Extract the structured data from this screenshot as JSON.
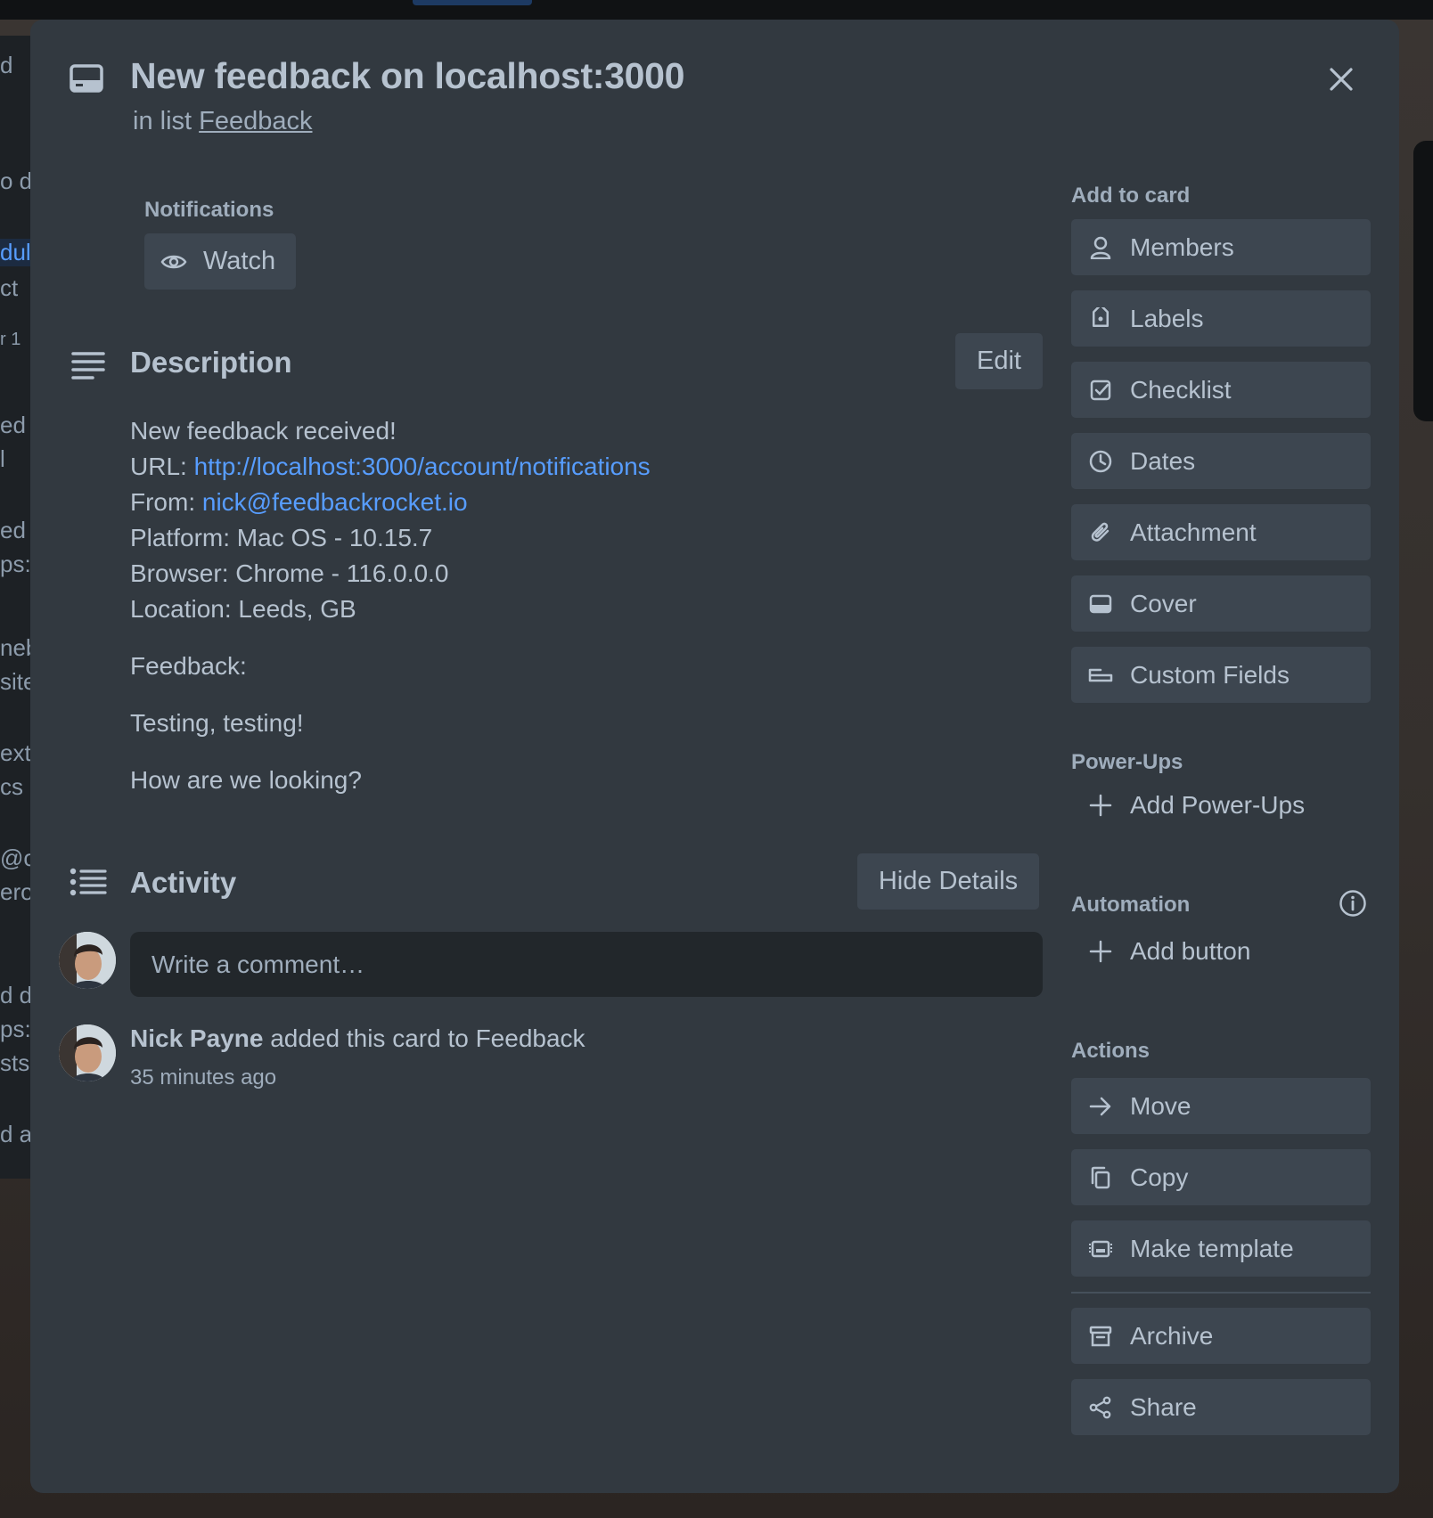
{
  "card": {
    "title": "New feedback on localhost:3000",
    "in_list_prefix": "in list",
    "list_name": "Feedback"
  },
  "notifications": {
    "label": "Notifications",
    "watch_label": "Watch"
  },
  "description": {
    "heading": "Description",
    "edit_label": "Edit",
    "intro": "New feedback received!",
    "url_label": "URL:",
    "url_value": "http://localhost:3000/account/notifications",
    "from_label": "From:",
    "from_value": "nick@feedbackrocket.io",
    "platform": "Platform: Mac OS - 10.15.7",
    "browser": "Browser: Chrome - 116.0.0.0",
    "location": "Location: Leeds, GB",
    "feedback_label": "Feedback:",
    "body_1": "Testing, testing!",
    "body_2": "How are we looking?"
  },
  "activity": {
    "heading": "Activity",
    "toggle_label": "Hide Details",
    "comment_placeholder": "Write a comment…",
    "items": [
      {
        "user": "Nick Payne",
        "text": "added this card to Feedback",
        "time": "35 minutes ago"
      }
    ]
  },
  "sidebar": {
    "add_to_card_label": "Add to card",
    "add_to_card": [
      {
        "label": "Members",
        "icon": "person-icon"
      },
      {
        "label": "Labels",
        "icon": "tag-icon"
      },
      {
        "label": "Checklist",
        "icon": "checkbox-icon"
      },
      {
        "label": "Dates",
        "icon": "clock-icon"
      },
      {
        "label": "Attachment",
        "icon": "paperclip-icon"
      },
      {
        "label": "Cover",
        "icon": "cover-icon"
      },
      {
        "label": "Custom Fields",
        "icon": "custom-fields-icon"
      }
    ],
    "power_ups_label": "Power-Ups",
    "add_power_ups": "Add Power-Ups",
    "automation_label": "Automation",
    "add_button": "Add button",
    "actions_label": "Actions",
    "actions": [
      {
        "label": "Move",
        "icon": "arrow-right-icon"
      },
      {
        "label": "Copy",
        "icon": "copy-icon"
      },
      {
        "label": "Make template",
        "icon": "template-icon"
      },
      {
        "label": "Archive",
        "icon": "archive-icon"
      },
      {
        "label": "Share",
        "icon": "share-icon"
      }
    ]
  },
  "background_fragments": [
    "d",
    "o d",
    "dul",
    "ct",
    "r 1",
    "ed",
    "l",
    "ed",
    "ps:",
    "neb",
    "site",
    "exti",
    "cs",
    "@ou",
    "ero",
    "d de",
    "ps:/",
    "sts",
    "d a"
  ],
  "colors": {
    "modal_bg": "#323940",
    "button_bg": "#3d4650",
    "text": "#b6c2cf",
    "subtle_text": "#9fadbc",
    "link": "#579dff",
    "comment_bg": "#22272b"
  }
}
